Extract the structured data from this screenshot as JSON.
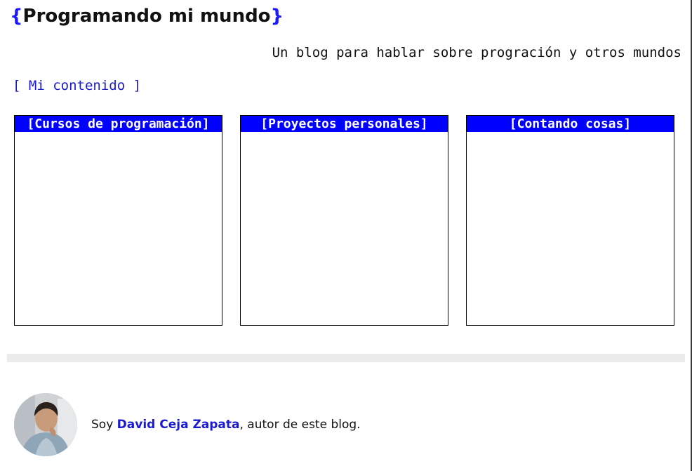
{
  "header": {
    "brace_open": "{",
    "title": "Programando mi mundo",
    "brace_close": "}",
    "tagline": "Un blog para hablar sobre progración y otros mundos"
  },
  "content": {
    "section_link": "[ Mi contenido ]",
    "cards": [
      {
        "title": "[Cursos de programación]"
      },
      {
        "title": "[Proyectos personales]"
      },
      {
        "title": "[Contando cosas]"
      }
    ]
  },
  "footer": {
    "prefix": "Soy ",
    "author_name": "David Ceja Zapata",
    "suffix": ", autor de este blog."
  },
  "colors": {
    "accent": "#0000ff",
    "link": "#1a1ad0",
    "divider": "#ebebeb"
  }
}
